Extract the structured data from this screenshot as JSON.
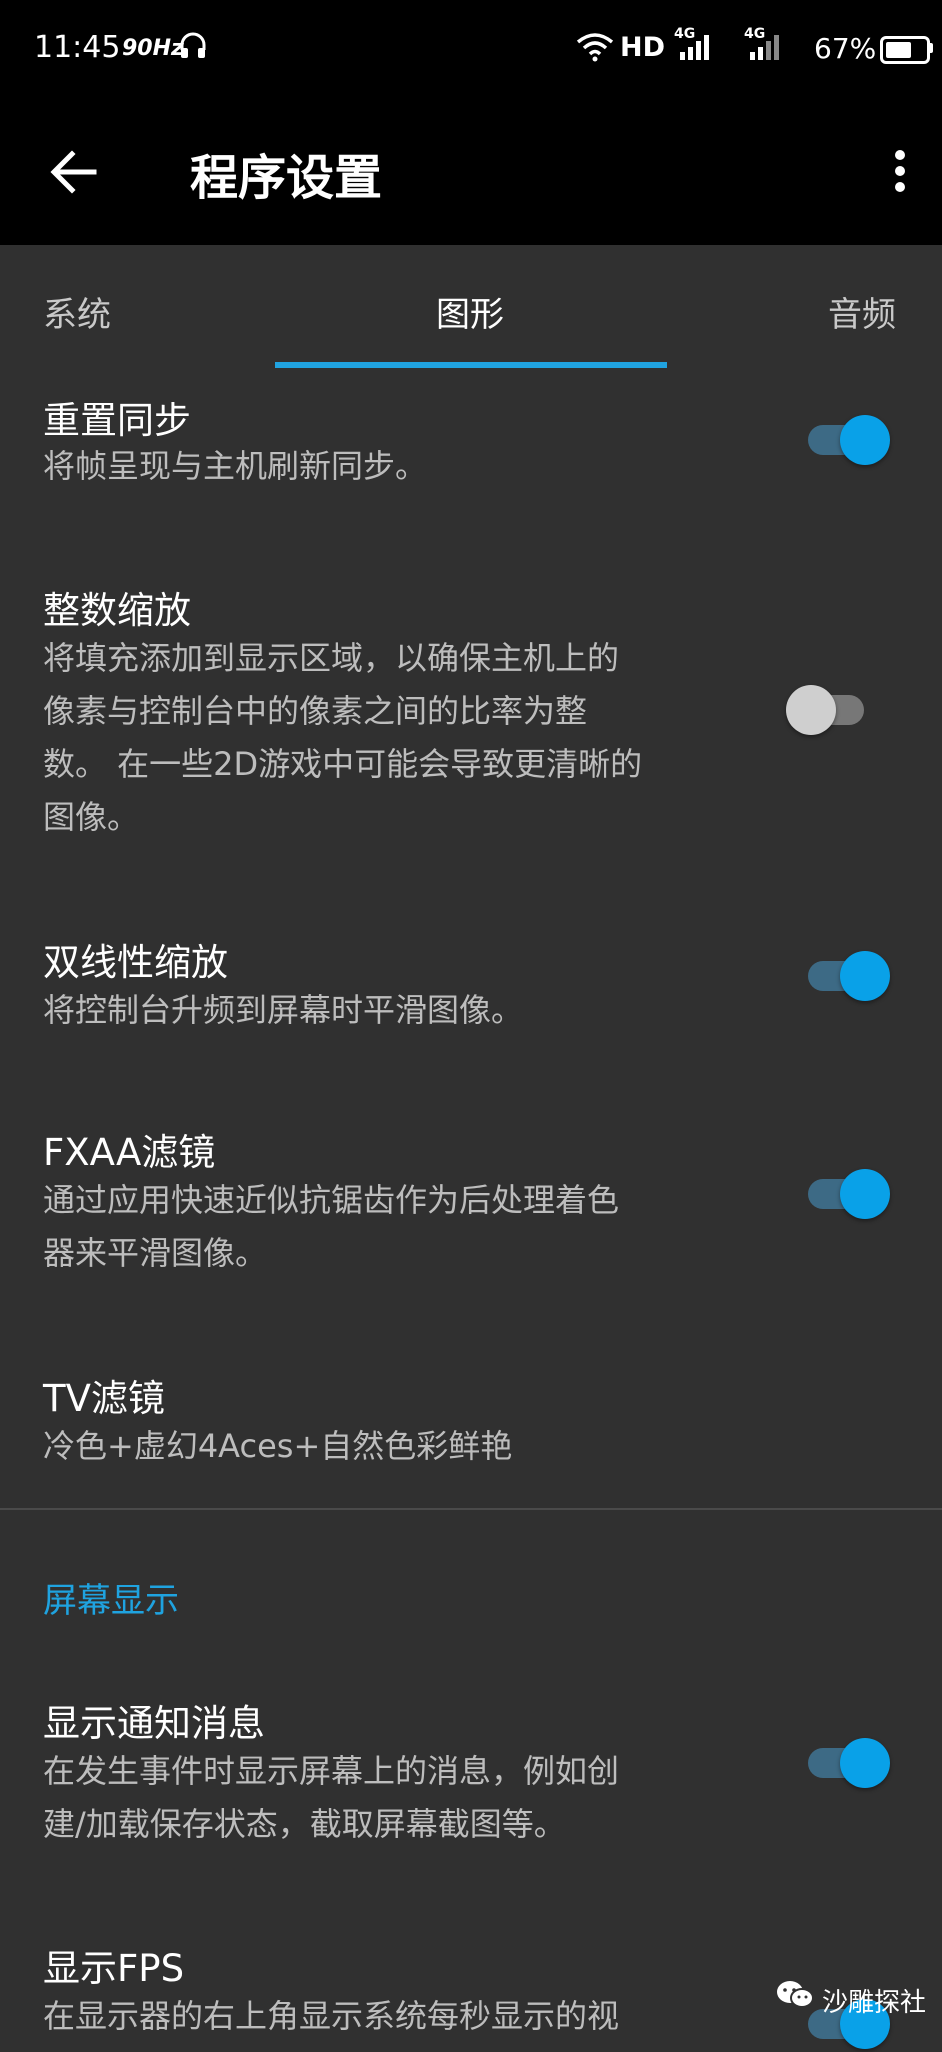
{
  "status_bar": {
    "time": "11:45",
    "refresh_rate": "90Hz",
    "network_hd": "HD",
    "signal_1": "4G",
    "signal_2": "4G",
    "battery_text": "67%",
    "battery_level": 0.67
  },
  "app_bar": {
    "title": "程序设置"
  },
  "tabs": [
    {
      "label": "系统"
    },
    {
      "label": "图形"
    },
    {
      "label": "音频"
    }
  ],
  "active_tab": "图形",
  "settings": [
    {
      "title": "重置同步",
      "description": "将帧呈现与主机刷新同步。",
      "toggle": true
    },
    {
      "title": "整数缩放",
      "description": "将填充添加到显示区域，以确保主机上的\n像素与控制台中的像素之间的比率为整\n数。 在一些2D游戏中可能会导致更清晰的\n图像。",
      "toggle": false
    },
    {
      "title": "双线性缩放",
      "description": "将控制台升频到屏幕时平滑图像。",
      "toggle": true
    },
    {
      "title": "FXAA滤镜",
      "description": "通过应用快速近似抗锯齿作为后处理着色\n器来平滑图像。",
      "toggle": true
    },
    {
      "title": "TV滤镜",
      "description": "冷色+虚幻4Aces+自然色彩鲜艳"
    },
    {
      "title": "显示通知消息",
      "description": "在发生事件时显示屏幕上的消息，例如创\n建/加载保存状态，截取屏幕截图等。",
      "toggle": true
    },
    {
      "title": "显示FPS",
      "description": "在显示器的右上角显示系统每秒显示的视",
      "toggle": true
    }
  ],
  "section_header": "屏幕显示",
  "watermark": "沙雕探社",
  "colors": {
    "accent": "#20a3e0",
    "background": "#303030",
    "toggle_on": "#09a1e8",
    "toggle_off": "#cfcfcf"
  }
}
